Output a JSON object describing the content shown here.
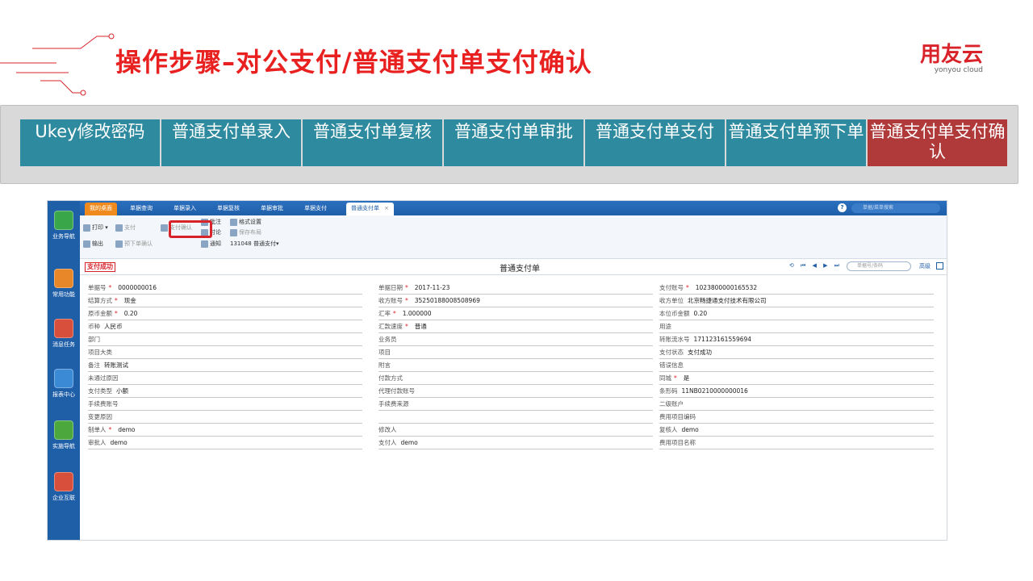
{
  "title": "操作步骤–对公支付/普通支付单支付确认",
  "logo": {
    "main": "用友云",
    "sub": "yonyou cloud"
  },
  "steps": [
    {
      "label": "Ukey修改密码"
    },
    {
      "label": "普通支付单录入"
    },
    {
      "label": "普通支付单复核"
    },
    {
      "label": "普通支付单审批"
    },
    {
      "label": "普通支付单支付"
    },
    {
      "label": "普通支付单预下单"
    },
    {
      "label": "普通支付单支付确认",
      "active": true
    }
  ],
  "app": {
    "nav": [
      "业务导航",
      "常用功能",
      "消息任务",
      "报表中心",
      "实施导航",
      "企业互联"
    ],
    "tabs": [
      "我的桌面",
      "单据查询",
      "单据录入",
      "单据复核",
      "单据审批",
      "单据支付",
      "普通支付单"
    ],
    "search_placeholder": "单据/菜单搜索",
    "toolbar": {
      "print": "打印",
      "pay": "支付",
      "confirm_pay": "支付确认",
      "export": "输出",
      "pre_confirm": "预下单确认",
      "approve_note": "批注",
      "discuss": "讨论",
      "notify": "通知",
      "format_set": "格式设置",
      "save_layout": "保存布局",
      "template": "131048 普通支付▾"
    },
    "form": {
      "stamp": "支付成功",
      "title": "普通支付单",
      "nav_arrows": "⟲ ⏮ ◀ ▶ ⏭",
      "search_placeholder": "单据号/条码",
      "advanced": "高级",
      "left": [
        {
          "label": "单据号",
          "req": true,
          "value": "0000000016"
        },
        {
          "label": "结算方式",
          "req": true,
          "value": "现金"
        },
        {
          "label": "原币金额",
          "req": true,
          "value": "0.20"
        },
        {
          "label": "币种",
          "req": false,
          "value": "人民币"
        },
        {
          "label": "部门",
          "req": false,
          "value": ""
        },
        {
          "label": "项目大类",
          "req": false,
          "value": ""
        },
        {
          "label": "备注",
          "req": false,
          "value": "转账测试"
        },
        {
          "label": "未通过原因",
          "req": false,
          "value": ""
        },
        {
          "label": "支付类型",
          "req": false,
          "value": "小额"
        },
        {
          "label": "手续费账号",
          "req": false,
          "value": ""
        },
        {
          "label": "变更原因",
          "req": false,
          "value": ""
        },
        {
          "label": "制单人",
          "req": true,
          "value": "demo"
        },
        {
          "label": "审批人",
          "req": false,
          "value": "demo"
        }
      ],
      "middle": [
        {
          "label": "单据日期",
          "req": true,
          "value": "2017-11-23"
        },
        {
          "label": "收方账号",
          "req": true,
          "value": "35250188008508969"
        },
        {
          "label": "汇率",
          "req": true,
          "value": "1.000000"
        },
        {
          "label": "汇款速度",
          "req": true,
          "value": "普通"
        },
        {
          "label": "业务员",
          "req": false,
          "value": ""
        },
        {
          "label": "项目",
          "req": false,
          "value": ""
        },
        {
          "label": "附言",
          "req": false,
          "value": ""
        },
        {
          "label": "付款方式",
          "req": false,
          "value": ""
        },
        {
          "label": "代理付款账号",
          "req": false,
          "value": ""
        },
        {
          "label": "手续费来源",
          "req": false,
          "value": ""
        },
        {
          "label": "",
          "req": false,
          "value": ""
        },
        {
          "label": "修改人",
          "req": false,
          "value": ""
        },
        {
          "label": "支付人",
          "req": false,
          "value": "demo"
        }
      ],
      "right": [
        {
          "label": "支付账号",
          "req": true,
          "value": "1023800000165532"
        },
        {
          "label": "收方单位",
          "req": false,
          "value": "北京畅捷通支付技术有限公司"
        },
        {
          "label": "本位币金额",
          "req": false,
          "value": "0.20"
        },
        {
          "label": "用途",
          "req": false,
          "value": ""
        },
        {
          "label": "转账流水号",
          "req": false,
          "value": "171123161559694"
        },
        {
          "label": "支付状态",
          "req": false,
          "value": "支付成功"
        },
        {
          "label": "错误信息",
          "req": false,
          "value": ""
        },
        {
          "label": "同城",
          "req": true,
          "value": "是"
        },
        {
          "label": "条形码",
          "req": false,
          "value": "11NB0210000000016"
        },
        {
          "label": "二级账户",
          "req": false,
          "value": ""
        },
        {
          "label": "费用项目编码",
          "req": false,
          "value": ""
        },
        {
          "label": "复核人",
          "req": false,
          "value": "demo"
        },
        {
          "label": "费用项目名称",
          "req": false,
          "value": ""
        }
      ]
    }
  }
}
